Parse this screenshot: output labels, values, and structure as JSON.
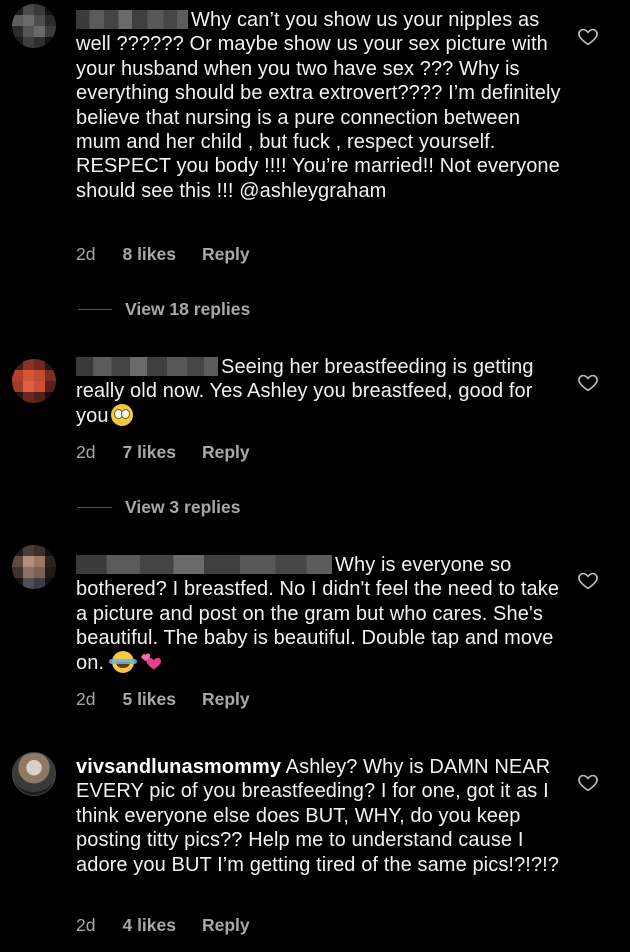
{
  "comments": [
    {
      "username_redacted": true,
      "text": "Why can’t you show us your nipples as well ?????? Or maybe show us your sex picture with your husband when you two have sex ??? Why is everything should be extra extrovert???? I’m definitely believe that nursing is a pure connection between mum and her child , but fuck , respect yourself. RESPECT you body !!!! You’re married!! Not everyone should see this !!! @ashleygraham",
      "age": "2d",
      "likes": "8 likes",
      "reply": "Reply",
      "view_replies": "View 18 replies"
    },
    {
      "username_redacted": true,
      "text": "Seeing her breastfeeding is getting really old now. Yes Ashley you breastfeed, good for you",
      "emoji": "face-with-rolling-eyes-icon",
      "age": "2d",
      "likes": "7 likes",
      "reply": "Reply",
      "view_replies": "View 3 replies"
    },
    {
      "username_redacted": true,
      "text": "Why is everyone so bothered? I breastfed. No I didn't feel the need to take a picture and post on the gram but who cares. She's beautiful. The baby is beautiful. Double tap and move on.",
      "emoji": [
        "face-with-tears-of-joy-icon",
        "two-hearts-icon"
      ],
      "age": "2d",
      "likes": "5 likes",
      "reply": "Reply"
    },
    {
      "username": "vivsandlunasmommy",
      "text": "Ashley?  Why is DAMN NEAR EVERY pic of you breastfeeding?  I for one, got it as I think everyone else does BUT, WHY, do you keep posting titty pics?? Help me to understand cause I adore you BUT I’m getting tired of the same pics!?!?!?",
      "age": "2d",
      "likes": "4 likes",
      "reply": "Reply"
    }
  ],
  "colors": {
    "background": "#000000",
    "text": "#f2f2f2",
    "meta": "#a8a8a8"
  }
}
